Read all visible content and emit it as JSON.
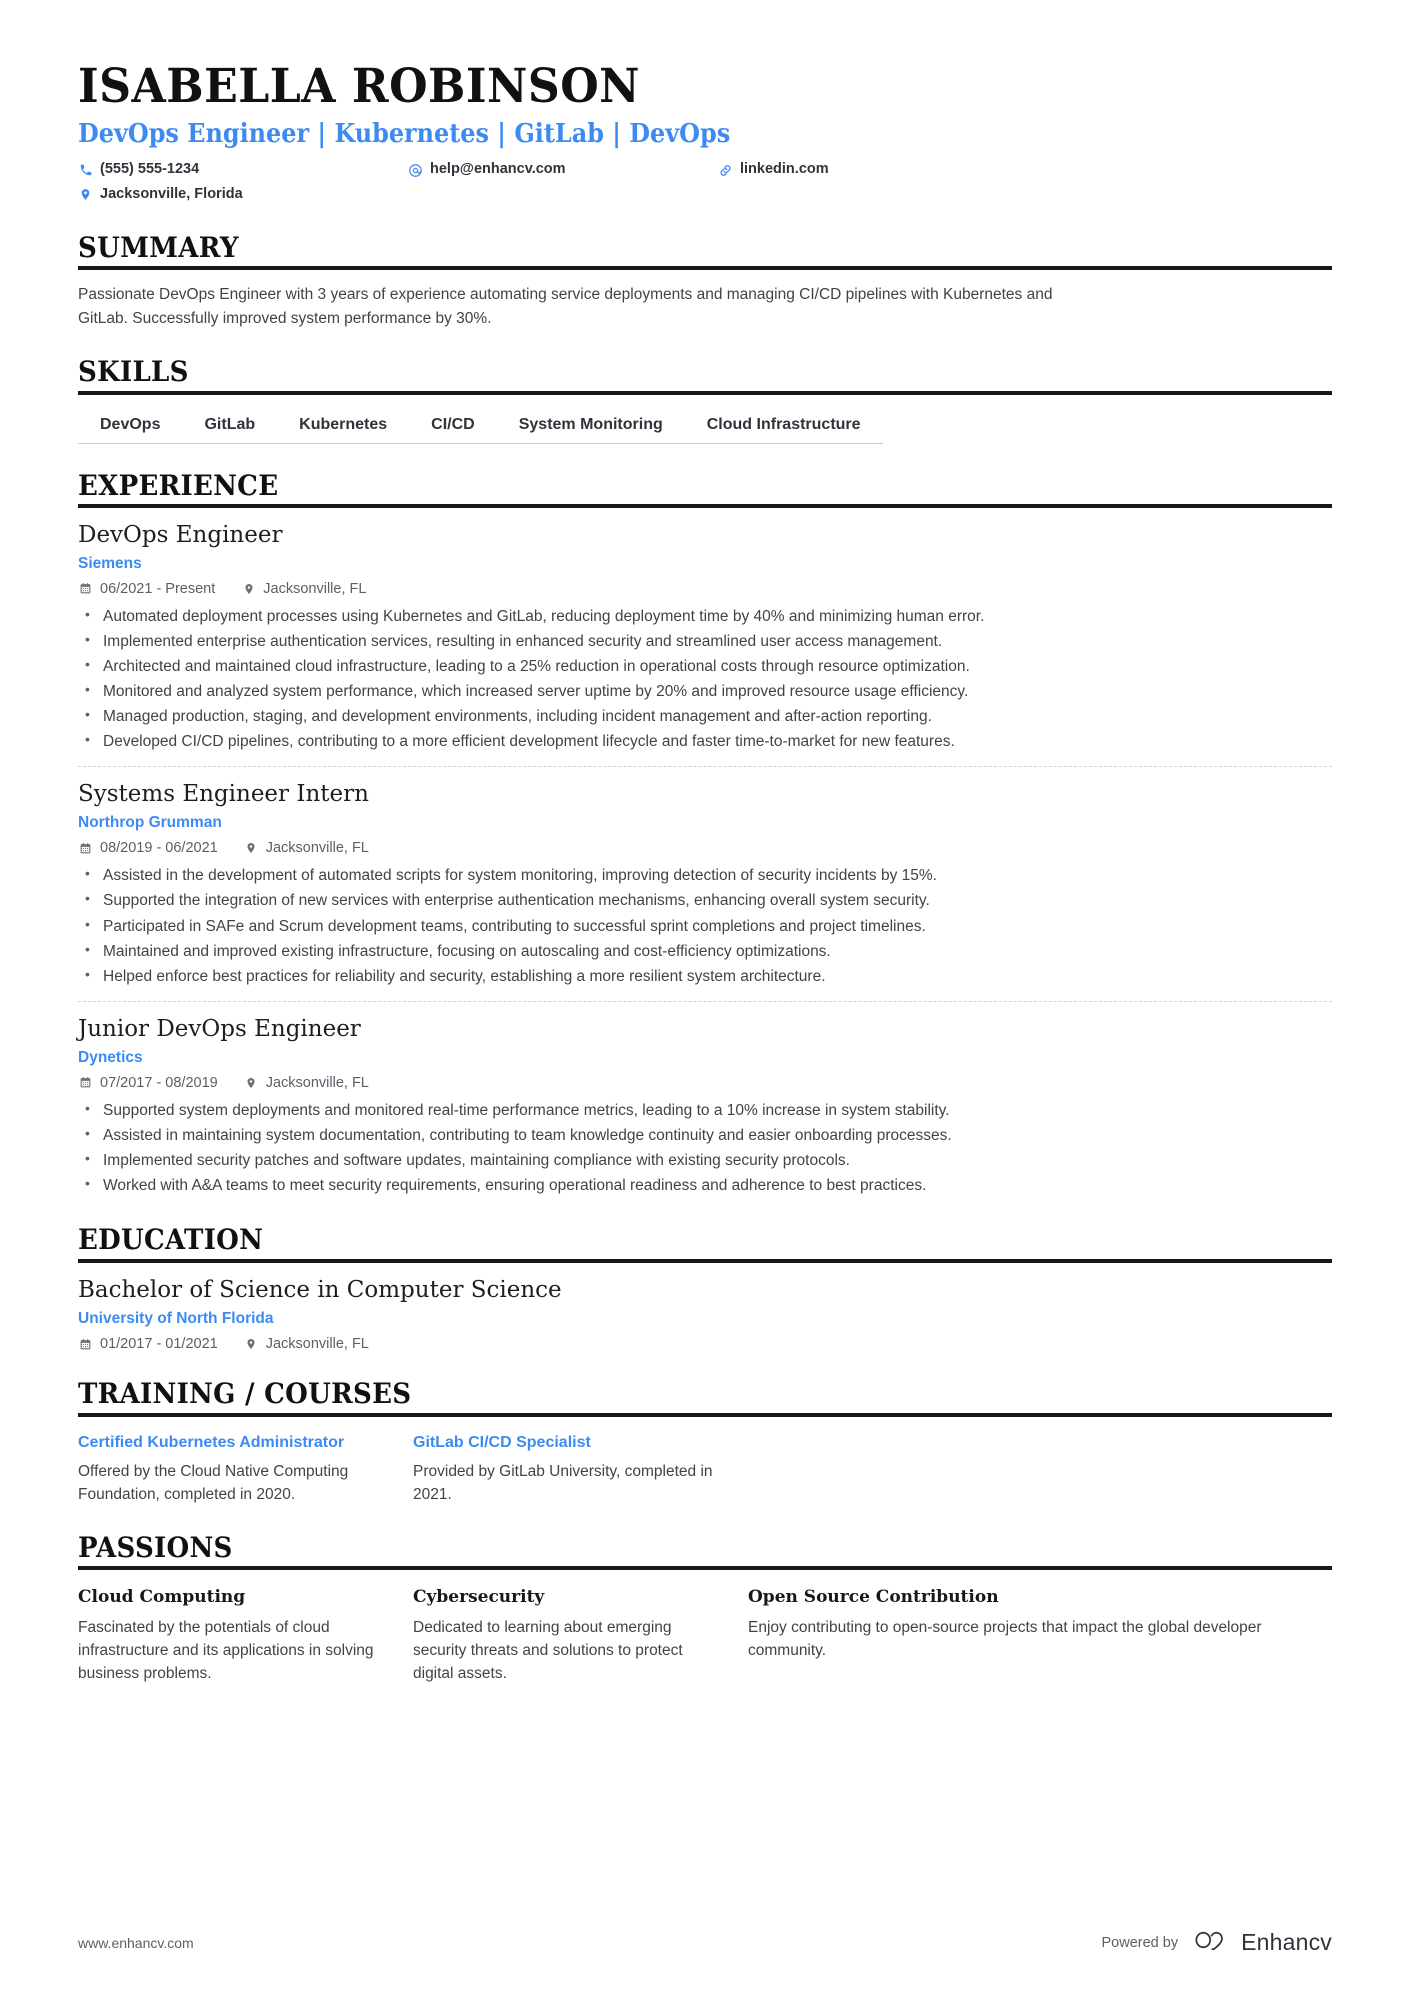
{
  "header": {
    "name": "ISABELLA ROBINSON",
    "headline": "DevOps Engineer | Kubernetes | GitLab | DevOps",
    "contacts": [
      {
        "icon": "phone-icon",
        "value": "(555) 555-1234"
      },
      {
        "icon": "email-icon",
        "value": "help@enhancv.com"
      },
      {
        "icon": "link-icon",
        "value": "linkedin.com"
      },
      {
        "icon": "location-icon",
        "value": "Jacksonville, Florida"
      }
    ]
  },
  "sections": {
    "summary": {
      "title": "SUMMARY",
      "text": "Passionate DevOps Engineer with 3 years of experience automating service deployments and managing CI/CD pipelines with Kubernetes and GitLab. Successfully improved system performance by 30%."
    },
    "skills": {
      "title": "SKILLS",
      "items": [
        "DevOps",
        "GitLab",
        "Kubernetes",
        "CI/CD",
        "System Monitoring",
        "Cloud Infrastructure"
      ]
    },
    "experience": {
      "title": "EXPERIENCE",
      "jobs": [
        {
          "title": "DevOps Engineer",
          "company": "Siemens",
          "dates": "06/2021 - Present",
          "location": "Jacksonville, FL",
          "bullets": [
            "Automated deployment processes using Kubernetes and GitLab, reducing deployment time by 40% and minimizing human error.",
            "Implemented enterprise authentication services, resulting in enhanced security and streamlined user access management.",
            "Architected and maintained cloud infrastructure, leading to a 25% reduction in operational costs through resource optimization.",
            "Monitored and analyzed system performance, which increased server uptime by 20% and improved resource usage efficiency.",
            "Managed production, staging, and development environments, including incident management and after-action reporting.",
            "Developed CI/CD pipelines, contributing to a more efficient development lifecycle and faster time-to-market for new features."
          ]
        },
        {
          "title": "Systems Engineer Intern",
          "company": "Northrop Grumman",
          "dates": "08/2019 - 06/2021",
          "location": "Jacksonville, FL",
          "bullets": [
            "Assisted in the development of automated scripts for system monitoring, improving detection of security incidents by 15%.",
            "Supported the integration of new services with enterprise authentication mechanisms, enhancing overall system security.",
            "Participated in SAFe and Scrum development teams, contributing to successful sprint completions and project timelines.",
            "Maintained and improved existing infrastructure, focusing on autoscaling and cost-efficiency optimizations.",
            "Helped enforce best practices for reliability and security, establishing a more resilient system architecture."
          ]
        },
        {
          "title": "Junior DevOps Engineer",
          "company": "Dynetics",
          "dates": "07/2017 - 08/2019",
          "location": "Jacksonville, FL",
          "bullets": [
            "Supported system deployments and monitored real-time performance metrics, leading to a 10% increase in system stability.",
            "Assisted in maintaining system documentation, contributing to team knowledge continuity and easier onboarding processes.",
            "Implemented security patches and software updates, maintaining compliance with existing security protocols.",
            "Worked with A&A teams to meet security requirements, ensuring operational readiness and adherence to best practices."
          ]
        }
      ]
    },
    "education": {
      "title": "EDUCATION",
      "entries": [
        {
          "degree": "Bachelor of Science in Computer Science",
          "school": "University of North Florida",
          "dates": "01/2017 - 01/2021",
          "location": "Jacksonville, FL"
        }
      ]
    },
    "training": {
      "title": "TRAINING / COURSES",
      "items": [
        {
          "title": "Certified Kubernetes Administrator",
          "description": "Offered by the Cloud Native Computing Foundation, completed in 2020."
        },
        {
          "title": "GitLab CI/CD Specialist",
          "description": "Provided by GitLab University, completed in 2021."
        }
      ]
    },
    "passions": {
      "title": "PASSIONS",
      "items": [
        {
          "title": "Cloud Computing",
          "description": "Fascinated by the potentials of cloud infrastructure and its applications in solving business problems."
        },
        {
          "title": "Cybersecurity",
          "description": "Dedicated to learning about emerging security threats and solutions to protect digital assets."
        },
        {
          "title": "Open Source Contribution",
          "description": "Enjoy contributing to open-source projects that impact the global developer community."
        }
      ]
    }
  },
  "footer": {
    "url": "www.enhancv.com",
    "powered_by": "Powered by",
    "brand": "Enhancv"
  },
  "colors": {
    "accent_blue": "#3d8bf2",
    "heading_black": "#0f1113",
    "body_gray": "#3f4449",
    "meta_gray": "#5a6068"
  }
}
